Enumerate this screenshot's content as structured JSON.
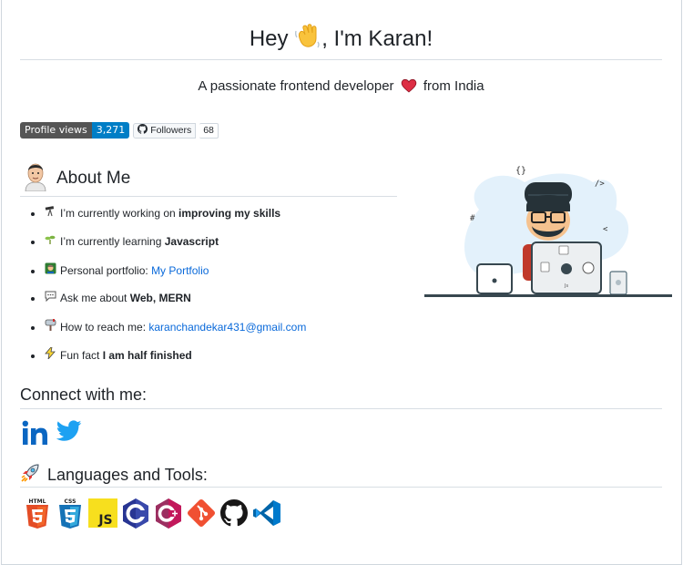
{
  "header": {
    "greeting_prefix": "Hey",
    "greeting_suffix": ", I'm Karan!",
    "wave_icon": "waving-hand-emoji"
  },
  "tagline": {
    "prefix": "A passionate frontend developer",
    "suffix": "from India",
    "heart_icon": "heart-emoji"
  },
  "badges": {
    "profile_views_label": "Profile views",
    "profile_views_count": "3,271",
    "followers_label": "Followers",
    "followers_count": "68"
  },
  "about": {
    "title": "About Me",
    "items": [
      {
        "icon": "telescope-emoji",
        "text": "I’m currently working on ",
        "strong": "improving my skills"
      },
      {
        "icon": "seedling-emoji",
        "text": "I’m currently learning ",
        "strong": "Javascript"
      },
      {
        "icon": "teacher-emoji",
        "text": "Personal portfolio: ",
        "link": "My Portfolio"
      },
      {
        "icon": "speech-bubble-emoji",
        "text": "Ask me about ",
        "strong": "Web, MERN"
      },
      {
        "icon": "mailbox-emoji",
        "text": "How to reach me: ",
        "link": "karanchandekar431@gmail.com"
      },
      {
        "icon": "lightning-emoji",
        "text": "Fun fact ",
        "strong": "I am half finished"
      }
    ]
  },
  "connect": {
    "title": "Connect with me:"
  },
  "tools": {
    "title": "Languages and Tools:",
    "items": [
      "html5-icon",
      "css3-icon",
      "javascript-icon",
      "c-icon",
      "cplusplus-icon",
      "git-icon",
      "github-icon",
      "vscode-icon"
    ]
  },
  "colors": {
    "linkedin": "#0a66c2",
    "twitter": "#1da1f2",
    "badge_blue": "#007ec6",
    "link": "#0969da"
  }
}
